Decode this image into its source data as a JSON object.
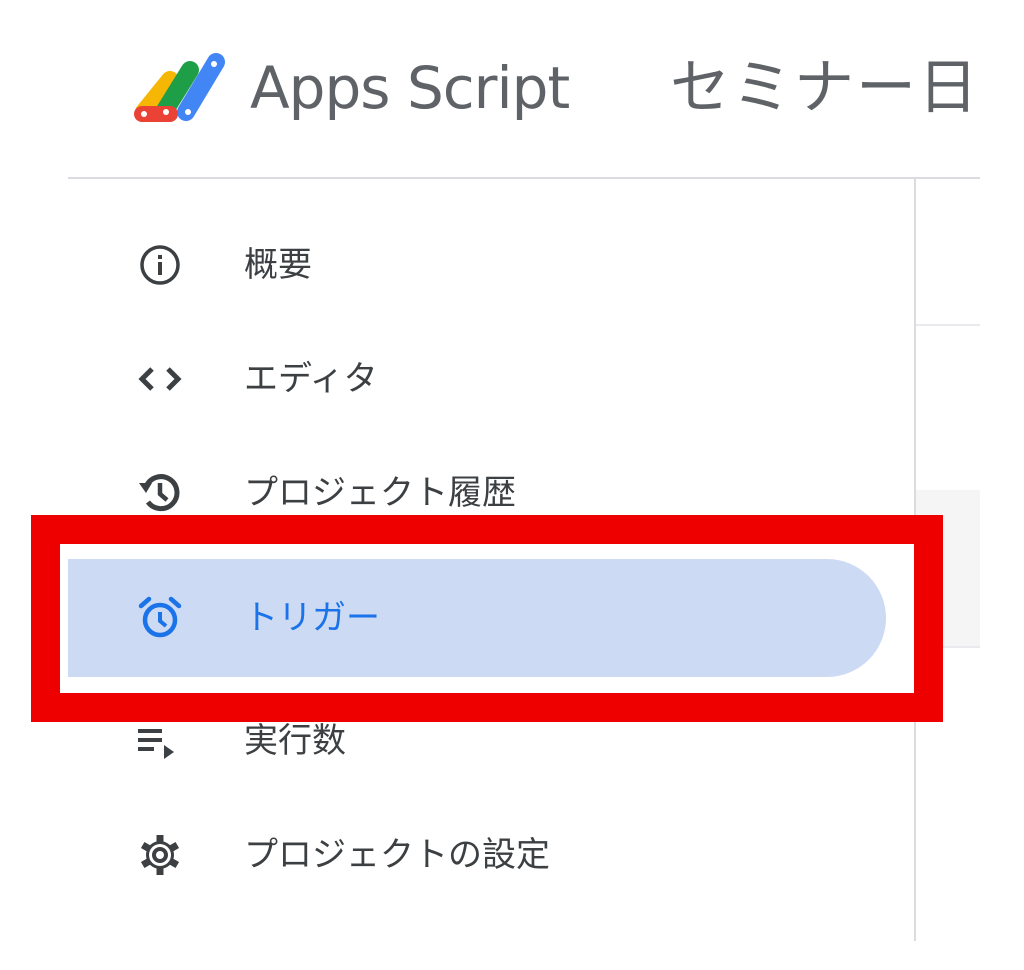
{
  "header": {
    "app_name": "Apps Script",
    "project_title": "セミナー日"
  },
  "sidebar": {
    "items": [
      {
        "label": "概要",
        "icon": "info-icon",
        "active": false
      },
      {
        "label": "エディタ",
        "icon": "code-icon",
        "active": false
      },
      {
        "label": "プロジェクト履歴",
        "icon": "history-icon",
        "active": false
      },
      {
        "label": "トリガー",
        "icon": "alarm-clock-icon",
        "active": true
      },
      {
        "label": "実行数",
        "icon": "playlist-play-icon",
        "active": false
      },
      {
        "label": "プロジェクトの設定",
        "icon": "gear-icon",
        "active": false
      }
    ]
  },
  "colors": {
    "active_background": "#ccdaf4",
    "active_text": "#1a73e8",
    "text": "#3c4043",
    "icon": "#3c4043",
    "highlight_annotation": "#ee0000",
    "divider": "#dadce0"
  }
}
